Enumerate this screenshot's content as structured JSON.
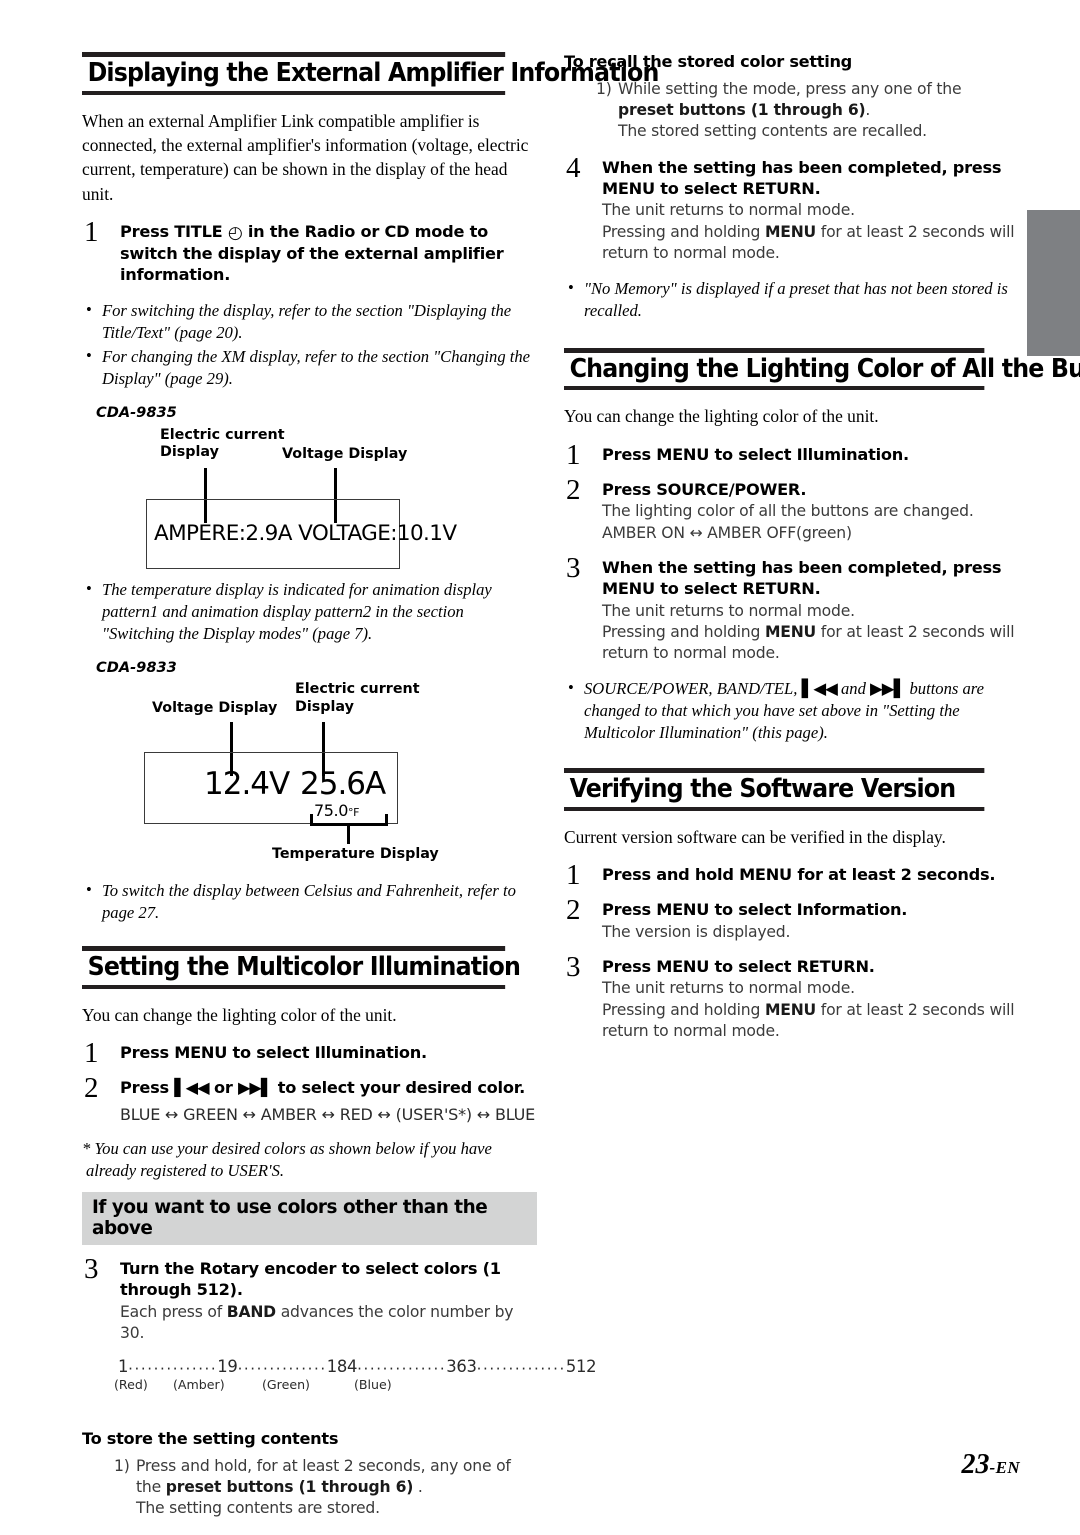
{
  "page": {
    "number": "23",
    "lang_suffix": "-EN",
    "edge_tab_color": "#7e8083",
    "gray_band_color": "#d3d4d4"
  },
  "left_column": {
    "section1": {
      "heading": "Displaying the External Amplifier Information",
      "intro": "When an external Amplifier Link compatible amplifier is connected, the external amplifier's information (voltage, electric current, temperature) can be shown in the display of the head unit.",
      "step1": {
        "num": "1",
        "title_pre": "Press ",
        "title_kbd": "TITLE",
        "title_icon": "clock-icon",
        "title_post": " in the Radio or CD mode to switch the display of the external amplifier information."
      },
      "notes": [
        "For switching the display, refer to the section \"Displaying the Title/Text\" (page 20).",
        "For changing the XM display, refer to the section \"Changing the Display\" (page 29)."
      ],
      "diagram1": {
        "model": "CDA-9835",
        "label_current": "Electric current\nDisplay",
        "label_voltage": "Voltage Display",
        "display_text": "AMPERE:2.9A  VOLTAGE:10.1V"
      },
      "note_temp": "The temperature display is indicated for animation display pattern1 and animation display pattern2 in the section \"Switching the Display modes\" (page 7).",
      "diagram2": {
        "model": "CDA-9833",
        "label_voltage": "Voltage Display",
        "label_current": "Electric current\nDisplay",
        "display_voltage": "12.4V",
        "display_current": "25.6A",
        "display_temp_value": "75.0",
        "display_temp_unit": "°F",
        "label_temperature": "Temperature Display"
      },
      "note_celsius": "To switch the display between Celsius and Fahrenheit, refer to page 27."
    },
    "section2": {
      "heading": "Setting the Multicolor Illumination",
      "intro": "You can change the lighting color of the unit.",
      "step1": {
        "num": "1",
        "title_pre": "Press ",
        "title_kbd": "MENU",
        "title_post": " to select Illumination."
      },
      "step2": {
        "num": "2",
        "title_pre": "Press ",
        "glyph_prev": "▌◀◀",
        "title_mid": " or ",
        "glyph_next": "▶▶▌",
        "title_post": " to select your desired color."
      },
      "color_cycle": "BLUE ↔ GREEN ↔ AMBER ↔ RED ↔ (USER'S*) ↔ BLUE",
      "footnote": "* You can use your desired colors as shown below if you have already registered to USER'S.",
      "gray_band": "If you want to use colors other than the above",
      "step3": {
        "num": "3",
        "title_pre": "Turn the ",
        "title_kbd": "Rotary encoder",
        "title_post": " to select colors (1 through 512).",
        "body_pre": "Each press of ",
        "body_kbd": "BAND",
        "body_post": " advances the color number by 30."
      },
      "scale": {
        "values": [
          "1",
          "19",
          "184",
          "363",
          "512"
        ],
        "labels": [
          "(Red)",
          "(Amber)",
          "(Green)",
          "(Blue)"
        ]
      },
      "store_heading": "To store the setting contents",
      "store_item": {
        "marker": "1)",
        "line1_pre": "Press and hold, for at least 2 seconds, any one of the ",
        "line1_kbd": "preset buttons (1 through 6)",
        "line1_post": " .",
        "line2": "The setting contents are stored."
      }
    }
  },
  "right_column": {
    "recall": {
      "heading": "To recall the stored color setting",
      "item": {
        "marker": "1)",
        "line1_pre": "While setting the mode, press any one of the ",
        "line1_kbd": "preset buttons (1 through 6)",
        "line1_post": ".",
        "line2": "The stored setting contents are recalled."
      }
    },
    "step4": {
      "num": "4",
      "title_pre": "When the setting has been completed, press ",
      "title_kbd": "MENU",
      "title_post": " to select RETURN.",
      "body_line1": "The unit returns to normal mode.",
      "body_line2_pre": "Pressing and holding ",
      "body_line2_kbd": "MENU",
      "body_line2_post": " for at least 2 seconds will return to normal mode."
    },
    "note_nomemory": "\"No Memory\" is displayed if a preset that has not been stored is recalled.",
    "section3": {
      "heading": "Changing the Lighting Color of All the Buttons",
      "intro": "You can change the lighting color of the unit.",
      "step1": {
        "num": "1",
        "title_pre": "Press ",
        "title_kbd": "MENU",
        "title_post": " to select Illumination."
      },
      "step2": {
        "num": "2",
        "title_pre": "Press ",
        "title_kbd": "SOURCE/POWER",
        "title_post": ".",
        "body_line1": "The lighting color of all the buttons are changed.",
        "body_line2": "AMBER ON ↔ AMBER OFF(green)"
      },
      "step3": {
        "num": "3",
        "title_pre": "When the setting has been completed, press ",
        "title_kbd": "MENU",
        "title_post": " to select RETURN.",
        "body_line1": "The unit returns to normal mode.",
        "body_line2_pre": "Pressing and holding ",
        "body_line2_kbd": "MENU",
        "body_line2_post": " for at least 2 seconds will return to normal mode."
      },
      "note_buttons_pre": "SOURCE/POWER, BAND/TEL, ",
      "note_glyph_prev": "▌◀◀",
      "note_buttons_mid": " and ",
      "note_glyph_next": "▶▶▌",
      "note_buttons_post": " buttons are changed to that which you have set above in \"Setting the Multicolor Illumination\" (this page)."
    },
    "section4": {
      "heading": "Verifying the Software Version",
      "intro": "Current version software can be verified in the display.",
      "step1": {
        "num": "1",
        "title_pre": "Press and hold ",
        "title_kbd": "MENU",
        "title_post": " for at least 2 seconds."
      },
      "step2": {
        "num": "2",
        "title_pre": "Press ",
        "title_kbd": "MENU",
        "title_post": " to select Information.",
        "body_line1": "The version is displayed."
      },
      "step3": {
        "num": "3",
        "title_pre": "Press ",
        "title_kbd": "MENU",
        "title_post": " to select RETURN.",
        "body_line1": "The unit returns to normal mode.",
        "body_line2_pre": "Pressing and holding ",
        "body_line2_kbd": "MENU",
        "body_line2_post": " for at least 2 seconds will return to normal mode."
      }
    }
  }
}
